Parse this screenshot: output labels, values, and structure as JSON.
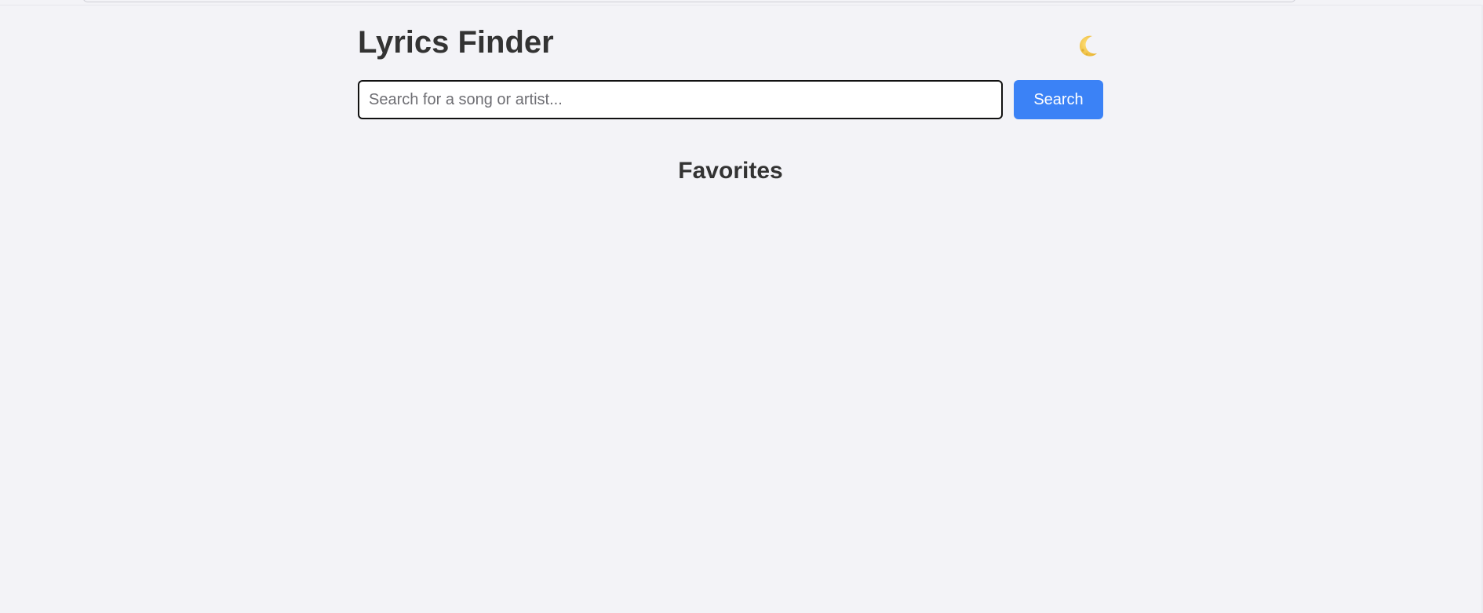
{
  "app": {
    "title": "Lyrics Finder"
  },
  "theme_toggle": {
    "icon": "moon-icon",
    "icon_color": "#f6c84c"
  },
  "search": {
    "placeholder": "Search for a song or artist...",
    "value": "",
    "button_label": "Search",
    "button_color": "#3b82f6"
  },
  "favorites": {
    "heading": "Favorites",
    "items": []
  },
  "colors": {
    "background": "#f3f3f7",
    "text": "#333333"
  }
}
